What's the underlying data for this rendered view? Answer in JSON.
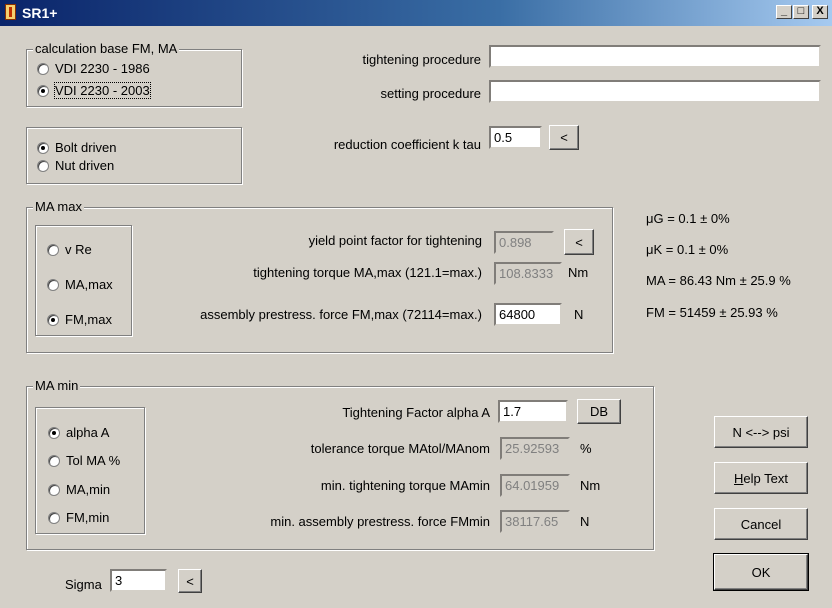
{
  "window": {
    "title": "SR1+",
    "controls": {
      "minimize": "_",
      "maximize": "□",
      "close": "X"
    }
  },
  "calc_base": {
    "legend": "calculation base FM, MA",
    "options": [
      {
        "label": "VDI 2230 - 1986",
        "checked": false
      },
      {
        "label": "VDI 2230 - 2003",
        "checked": true
      }
    ]
  },
  "procedures": {
    "tightening_label": "tightening procedure",
    "tightening_value": "",
    "setting_label": "setting procedure",
    "setting_value": ""
  },
  "drive": {
    "options": [
      {
        "label": "Bolt driven",
        "checked": true
      },
      {
        "label": "Nut driven",
        "checked": false
      }
    ]
  },
  "reduction": {
    "label": "reduction coefficient k tau",
    "value": "0.5",
    "button": "<"
  },
  "ma_max": {
    "legend": "MA max",
    "options": [
      {
        "label": "v Re",
        "checked": false
      },
      {
        "label": "MA,max",
        "checked": false
      },
      {
        "label": "FM,max",
        "checked": true
      }
    ],
    "yield_label": "yield point factor for tightening",
    "yield_value": "0.898",
    "yield_button": "<",
    "torque_label": "tightening torque MA,max (121.1=max.)",
    "torque_value": "108.8333",
    "torque_unit": "Nm",
    "force_label": "assembly prestress. force FM,max (72114=max.)",
    "force_value": "64800",
    "force_unit": "N"
  },
  "results": {
    "mu_g": "μG = 0.1 ± 0%",
    "mu_k": "μK = 0.1 ± 0%",
    "ma": "MA = 86.43 Nm ± 25.9 %",
    "fm": "FM = 51459 ± 25.93 %"
  },
  "ma_min": {
    "legend": "MA min",
    "options": [
      {
        "label": "alpha A",
        "checked": true
      },
      {
        "label": "Tol MA %",
        "checked": false
      },
      {
        "label": "MA,min",
        "checked": false
      },
      {
        "label": "FM,min",
        "checked": false
      }
    ],
    "alpha_label": "Tightening Factor alpha A",
    "alpha_value": "1.7",
    "db_button": "DB",
    "tol_label": "tolerance torque  MAtol/MAnom",
    "tol_value": "25.92593",
    "tol_unit": "%",
    "mamin_label": "min. tightening torque MAmin",
    "mamin_value": "64.01959",
    "mamin_unit": "Nm",
    "fmmin_label": "min. assembly prestress. force FMmin",
    "fmmin_value": "38117.65",
    "fmmin_unit": "N"
  },
  "sigma": {
    "label": "Sigma",
    "value": "3",
    "button": "<"
  },
  "buttons": {
    "units": "N <--> psi",
    "help_first": "H",
    "help_rest": "elp Text",
    "cancel": "Cancel",
    "ok": "OK"
  }
}
